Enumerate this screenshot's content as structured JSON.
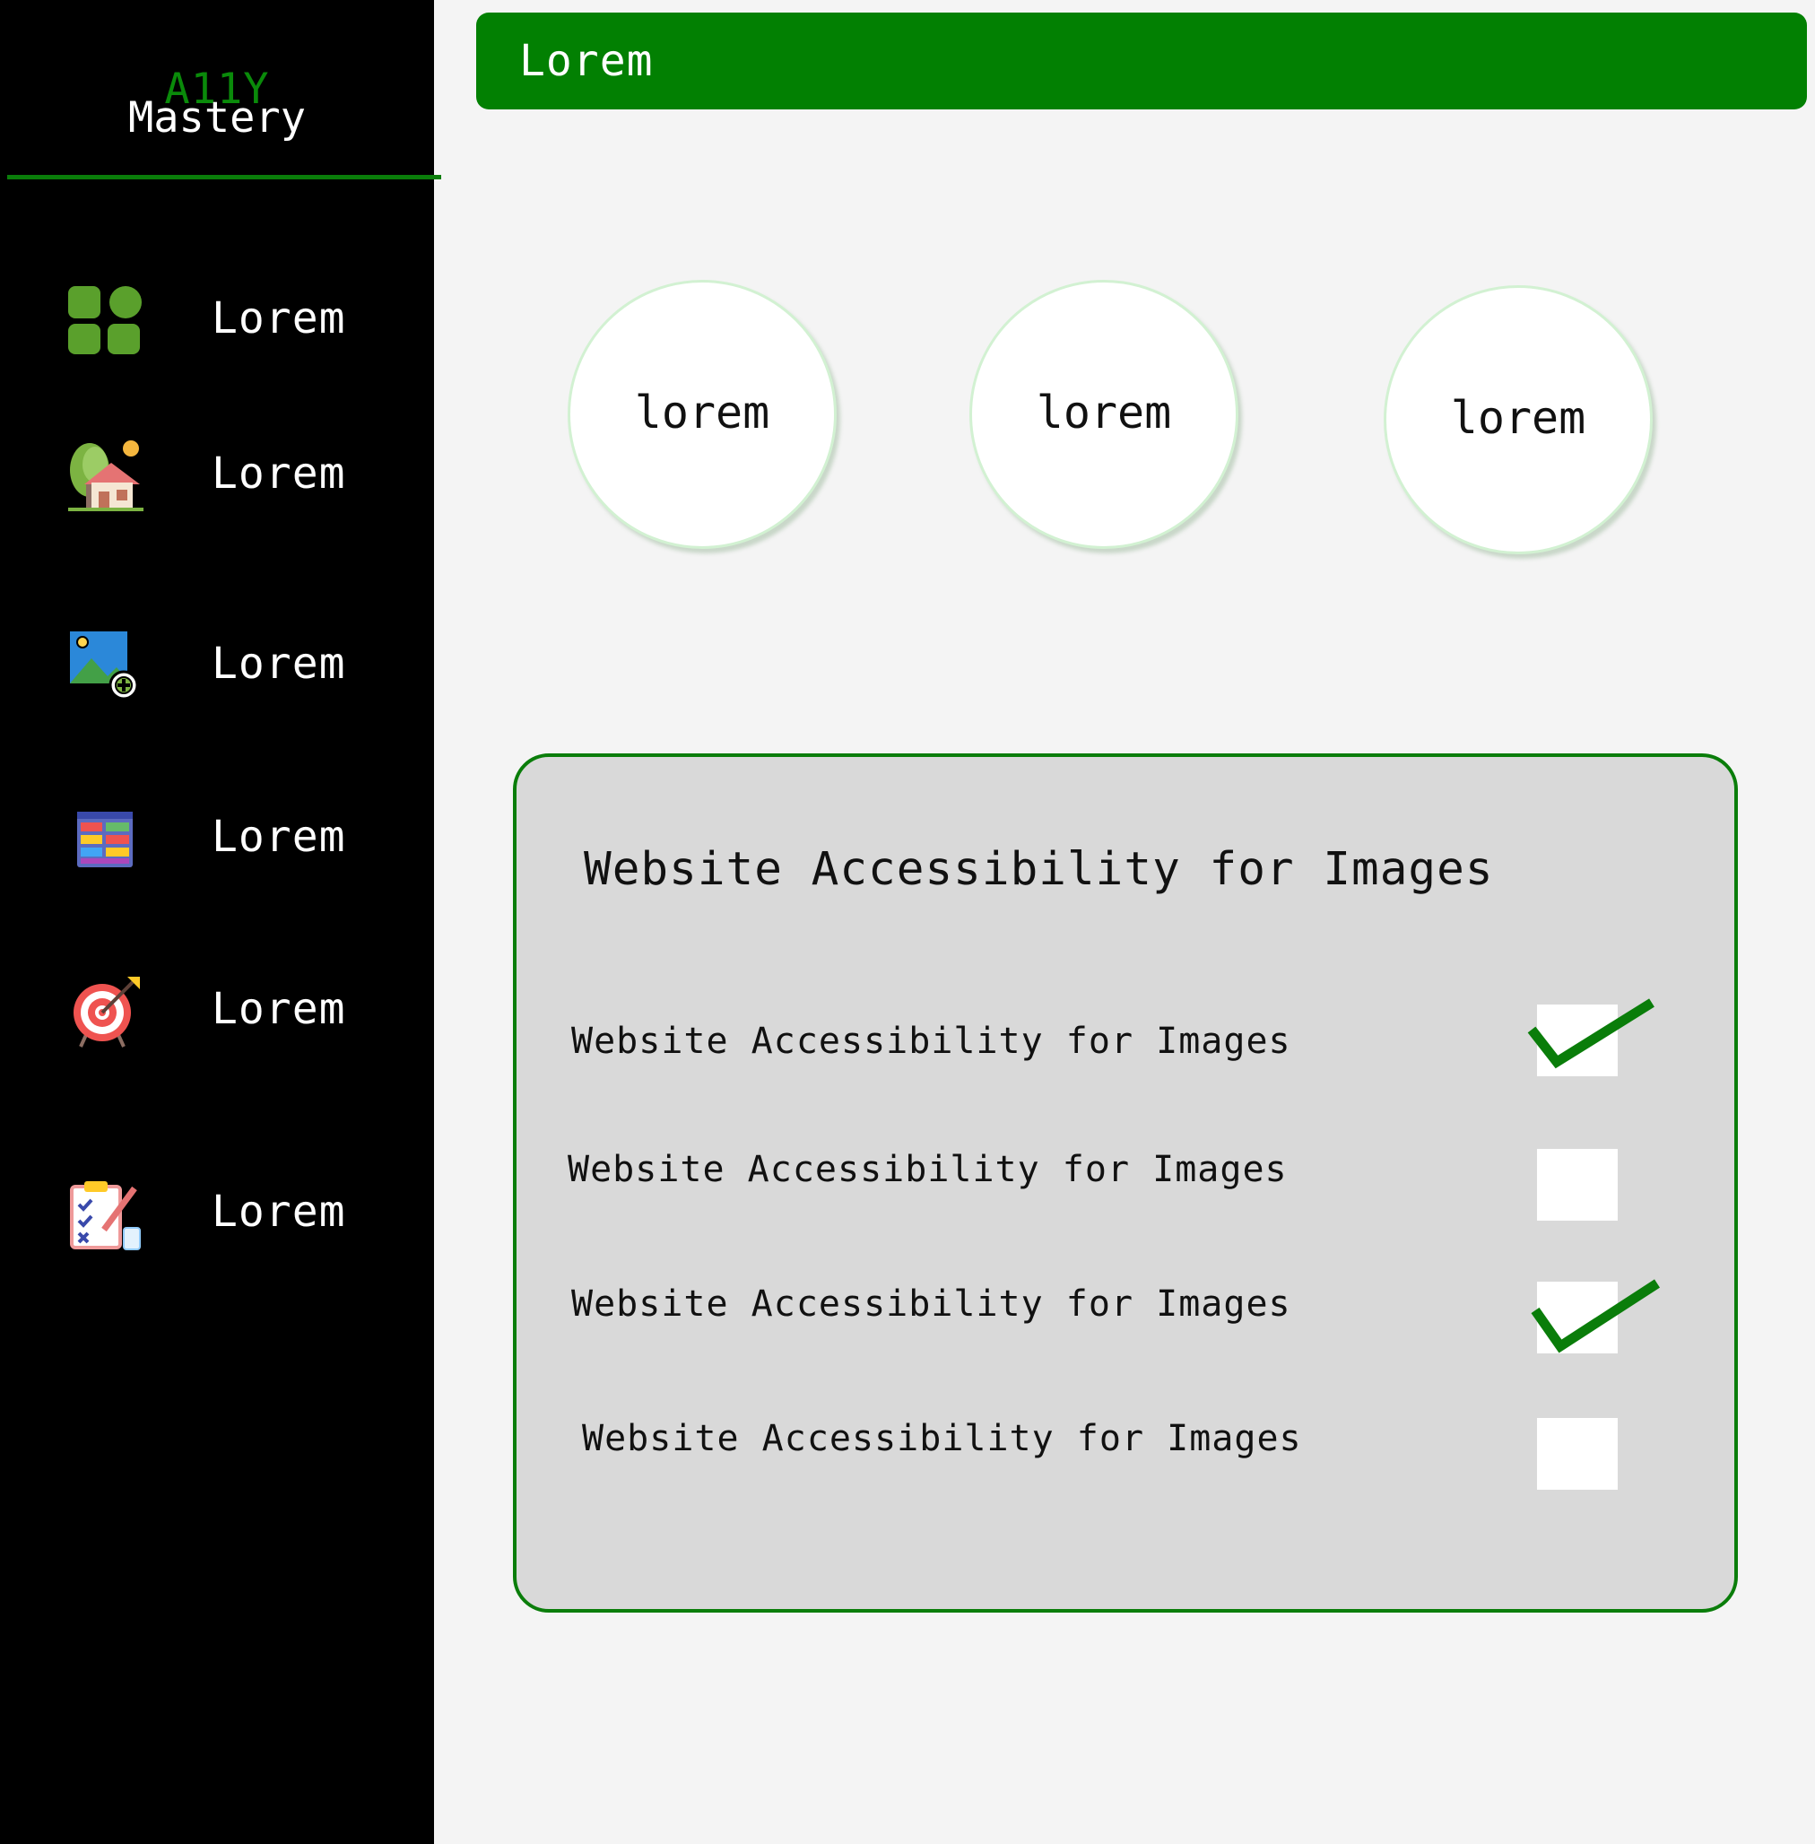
{
  "sidebar": {
    "brand_top": "A11Y",
    "brand_bottom": "Mastery",
    "items": [
      {
        "label": "Lorem",
        "icon": "dashboard-grid-icon"
      },
      {
        "label": "Lorem",
        "icon": "house-icon"
      },
      {
        "label": "Lorem",
        "icon": "add-image-icon"
      },
      {
        "label": "Lorem",
        "icon": "layout-grid-icon"
      },
      {
        "label": "Lorem",
        "icon": "target-icon"
      },
      {
        "label": "Lorem",
        "icon": "checklist-clipboard-icon"
      }
    ]
  },
  "header": {
    "title": "Lorem"
  },
  "circles": [
    {
      "label": "lorem"
    },
    {
      "label": "lorem"
    },
    {
      "label": "lorem"
    }
  ],
  "card": {
    "title": "Website Accessibility for Images",
    "items": [
      {
        "label": "Website Accessibility for Images",
        "checked": true
      },
      {
        "label": "Website Accessibility for Images",
        "checked": false
      },
      {
        "label": "Website Accessibility for Images",
        "checked": true
      },
      {
        "label": "Website Accessibility for Images",
        "checked": false
      }
    ]
  },
  "colors": {
    "accent_green": "#028002",
    "sidebar_bg": "#000000",
    "page_bg": "#f4f4f4",
    "card_bg": "#d9d9d9"
  }
}
